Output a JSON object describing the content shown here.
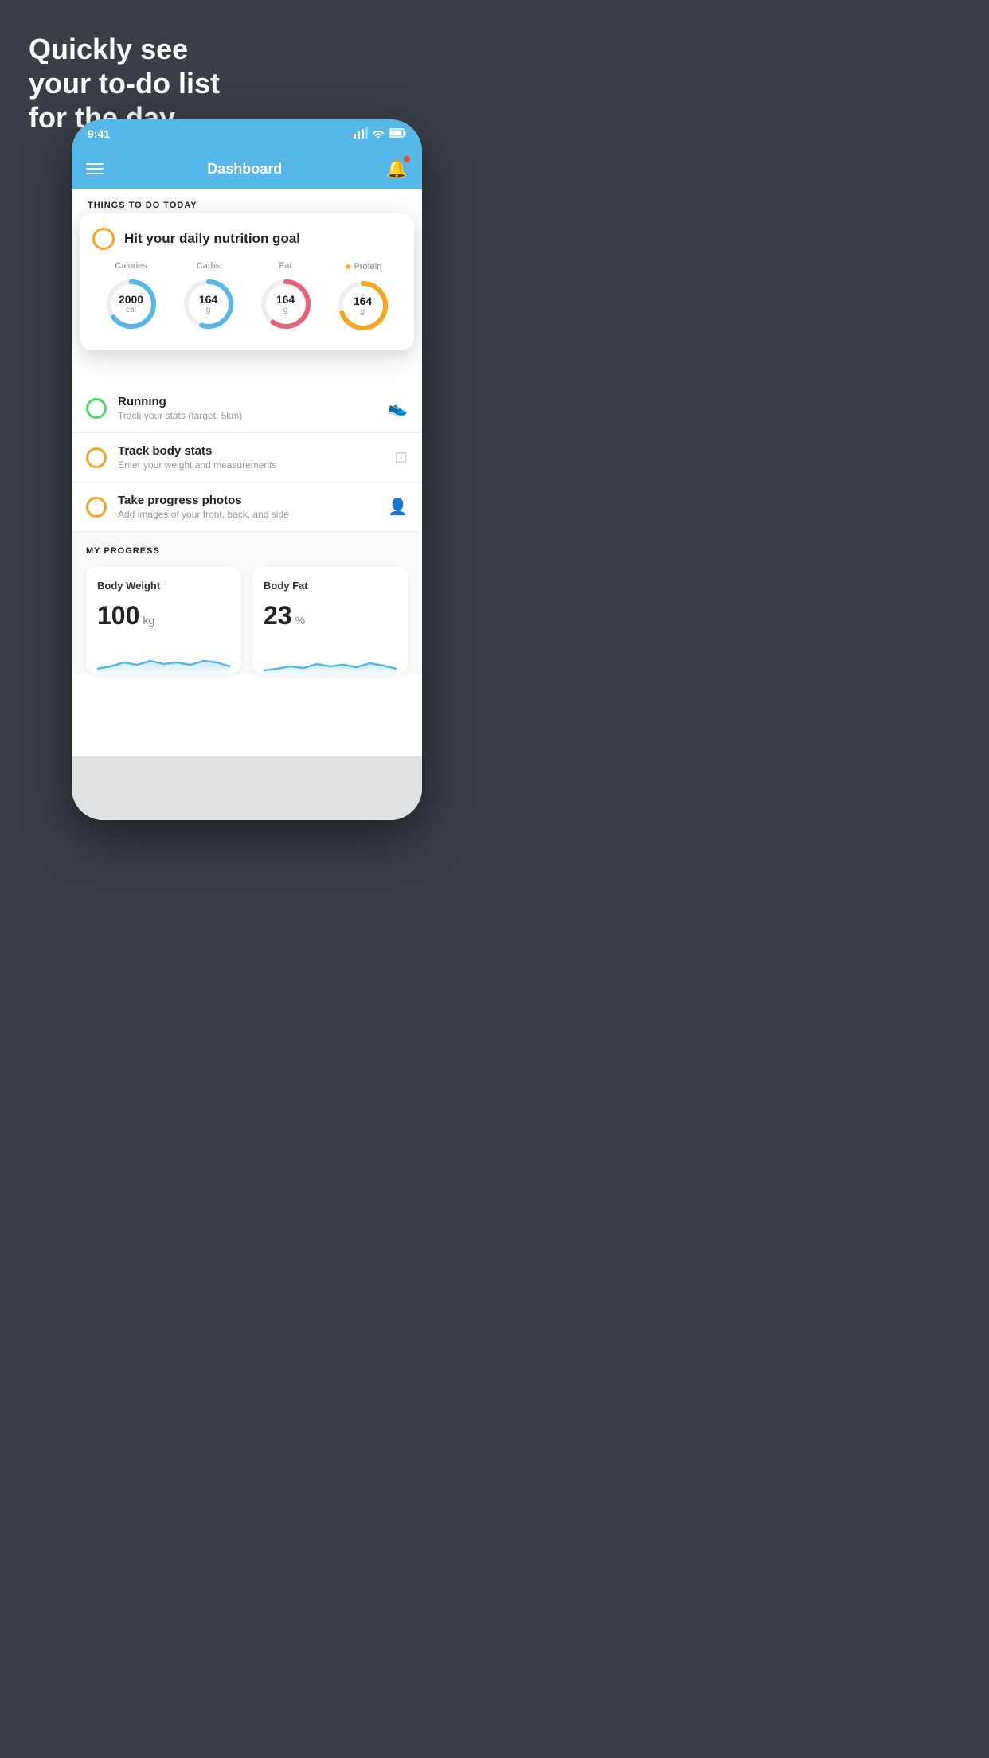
{
  "hero": {
    "line1": "Quickly see",
    "line2": "your to-do list",
    "line3": "for the day."
  },
  "status_bar": {
    "time": "9:41",
    "signal": "▋▋▋▋",
    "wifi": "WiFi",
    "battery": "🔋"
  },
  "header": {
    "title": "Dashboard"
  },
  "things_label": "THINGS TO DO TODAY",
  "floating_card": {
    "title": "Hit your daily nutrition goal",
    "nutrition": [
      {
        "label": "Calories",
        "value": "2000",
        "unit": "cal",
        "color": "#55b8e8",
        "pct": 65,
        "star": false
      },
      {
        "label": "Carbs",
        "value": "164",
        "unit": "g",
        "color": "#55b8e8",
        "pct": 55,
        "star": false
      },
      {
        "label": "Fat",
        "value": "164",
        "unit": "g",
        "color": "#e8607a",
        "pct": 60,
        "star": false
      },
      {
        "label": "Protein",
        "value": "164",
        "unit": "g",
        "color": "#f5a623",
        "pct": 70,
        "star": true
      }
    ]
  },
  "todo_items": [
    {
      "label": "Running",
      "sub": "Track your stats (target: 5km)",
      "circle": "green",
      "icon": "👟"
    },
    {
      "label": "Track body stats",
      "sub": "Enter your weight and measurements",
      "circle": "yellow",
      "icon": "⊡"
    },
    {
      "label": "Take progress photos",
      "sub": "Add images of your front, back, and side",
      "circle": "yellow",
      "icon": "👤"
    }
  ],
  "progress": {
    "title": "MY PROGRESS",
    "cards": [
      {
        "title": "Body Weight",
        "value": "100",
        "unit": "kg"
      },
      {
        "title": "Body Fat",
        "value": "23",
        "unit": "%"
      }
    ]
  }
}
